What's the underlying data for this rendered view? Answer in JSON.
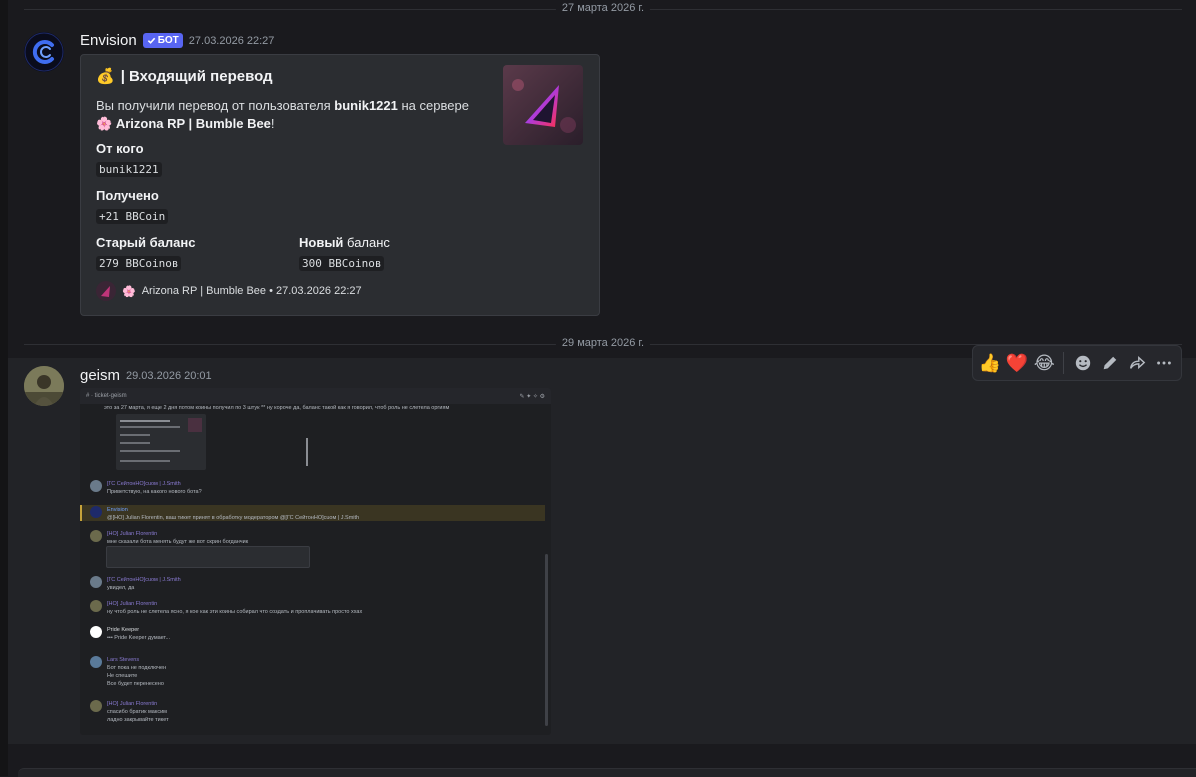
{
  "dividers": {
    "first": "27 марта 2026 г.",
    "second": "29 марта 2026 г."
  },
  "messages": {
    "envision": {
      "username": "Envision",
      "bot_tag": "БОТ",
      "timestamp": "27.03.2026 22:27",
      "embed": {
        "title_emoji": "💰",
        "title": "| Входящий перевод",
        "desc_prefix": "Вы получили перевод от пользователя",
        "desc_user": "bunik1221",
        "desc_middle": "на сервере",
        "desc_emoji": "🌸",
        "desc_server": "Arizona RP | Bumble Bee",
        "desc_suffix": "!",
        "fields": {
          "from_name": "От кого",
          "from_value": "bunik1221",
          "received_name": "Получено",
          "received_value": "+21 BBCoin",
          "old_name": "Старый баланс",
          "old_value": "279 BBCoinов",
          "new_name_bold": "Новый",
          "new_name_rest": "баланс",
          "new_value": "300 BBCoinов"
        },
        "footer_emoji": "🌸",
        "footer_text": "Arizona RP | Bumble Bee • 27.03.2026 22:27"
      }
    },
    "geism": {
      "username": "geism",
      "timestamp": "29.03.2026 20:01",
      "attachment": {
        "channel": "ticket-geism",
        "lines": {
          "l1": "это за 27 марта, я еще 2 дня потом коины получил по 3 штук ** ну короче да, баланс такой как я говорил, чтоб роль не слетела оргиям",
          "r1_name": "[ГС СейтонНО]cuoм | J.Smith",
          "r1_text": "Приветствую, на какого нового бота?",
          "r2_name": "Envision",
          "r2_text": "@[НО] Julian Florentin, ваш тикет принят в обработку модератором @[ГС СейтонНО]cuoм | J.Smith",
          "r3_name": "[НО] Julian Florentin",
          "r3_text": "мне сказали бота менять будут же вот скрин богданчик",
          "r4_name": "[ГС СейтонНО]cuoм | J.Smith",
          "r4_text": "увидел, да",
          "r5_name": "[НО] Julian Florentin",
          "r5_text": "ну чтоб роль не слетела ясно, я кое как эти коины собирал что создать и проплачивать просто ххах",
          "r6_name": "Pride Keeper",
          "r6_text": "••• Pride Keeper думает...",
          "r7_name": "Lars Stevens",
          "r7_text1": "Бот пока не подключен",
          "r7_text2": "Не спешите",
          "r7_text3": "Все будет перенесено",
          "r8_name": "[НО] Julian Florentin",
          "r8_text1": "спасибо братик максим",
          "r8_text2": "ладно закрывайте тикет"
        }
      }
    }
  },
  "reaction_bar": {
    "thumbs": "👍",
    "heart": "❤️",
    "laugh": "😂"
  },
  "colors": {
    "accent": "#5865f2",
    "background": "#1a1a1e",
    "embed": "#2b2d31"
  }
}
